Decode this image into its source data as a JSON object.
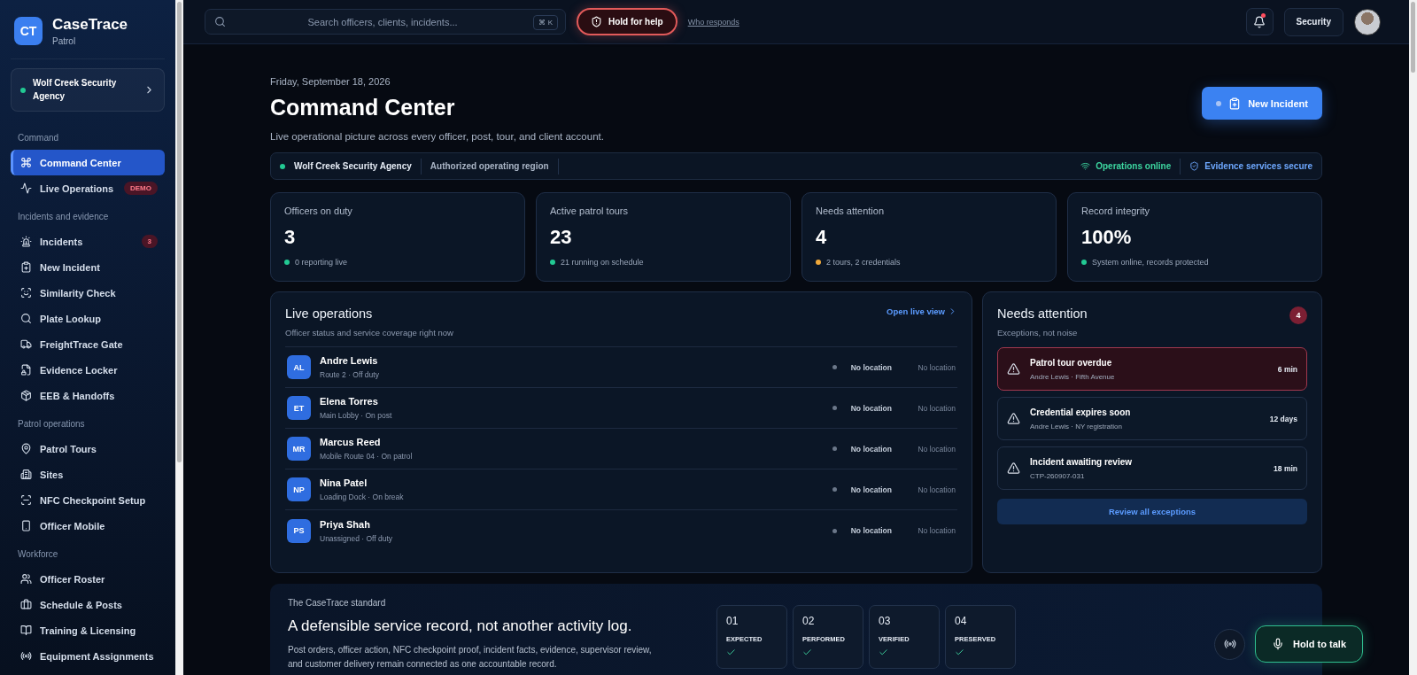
{
  "brand": {
    "logo": "CT",
    "name": "CaseTrace",
    "product": "Patrol"
  },
  "agency": {
    "name": "Wolf Creek Security Agency"
  },
  "sidebar": {
    "sections": [
      {
        "title": "Command",
        "items": [
          {
            "label": "Command Center",
            "selected": true
          },
          {
            "label": "Live Operations",
            "selected": false,
            "badge": "DEMO"
          }
        ]
      },
      {
        "title": "Incidents and evidence",
        "items": [
          {
            "label": "Incidents",
            "selected": false,
            "badge": "3"
          },
          {
            "label": "New Incident",
            "selected": false
          },
          {
            "label": "Similarity Check",
            "selected": false
          },
          {
            "label": "Plate Lookup",
            "selected": false
          },
          {
            "label": "FreightTrace Gate",
            "selected": false
          },
          {
            "label": "Evidence Locker",
            "selected": false
          },
          {
            "label": "EEB & Handoffs",
            "selected": false
          }
        ]
      },
      {
        "title": "Patrol operations",
        "items": [
          {
            "label": "Patrol Tours",
            "selected": false
          },
          {
            "label": "Sites",
            "selected": false
          },
          {
            "label": "NFC Checkpoint Setup",
            "selected": false
          },
          {
            "label": "Officer Mobile",
            "selected": false
          }
        ]
      },
      {
        "title": "Workforce",
        "items": [
          {
            "label": "Officer Roster",
            "selected": false
          },
          {
            "label": "Schedule & Posts",
            "selected": false
          },
          {
            "label": "Training & Licensing",
            "selected": false
          },
          {
            "label": "Equipment Assignments",
            "selected": false
          }
        ]
      }
    ]
  },
  "topbar": {
    "search": {
      "placeholder": "Search officers, clients, incidents...",
      "shortcut": "⌘ K"
    },
    "help_button": "Hold for help",
    "help_link": "Who responds",
    "notifications": {
      "unread": true
    },
    "role_button": "Security"
  },
  "header": {
    "date": "Friday, September 18, 2026",
    "title": "Command Center",
    "subtitle": "Live operational picture across every officer, post, tour, and client account.",
    "action": "New Incident"
  },
  "status_strip": {
    "agency": {
      "name": "Wolf Creek Security Agency",
      "color": "#22c993"
    },
    "region": "Authorized operating region",
    "indicators": [
      {
        "kind": "network",
        "label": "Operations online",
        "color": "#3dd6a0"
      },
      {
        "kind": "shield",
        "label": "Evidence services secure",
        "color": "#6ea8ff"
      }
    ]
  },
  "stats": [
    {
      "label": "Officers on duty",
      "value": "3",
      "note": "0 reporting live",
      "color": "#22c993"
    },
    {
      "label": "Active patrol tours",
      "value": "23",
      "note": "21 running on schedule",
      "color": "#22c993"
    },
    {
      "label": "Needs attention",
      "value": "4",
      "note": "2 tours, 2 credentials",
      "color": "#f0a83a"
    },
    {
      "label": "Record integrity",
      "value": "100%",
      "note": "System online, records protected",
      "color": "#22c993"
    }
  ],
  "live_operations": {
    "title": "Live operations",
    "subtitle": "Officer status and service coverage right now",
    "link": "Open live view",
    "officers": [
      {
        "initials": "AL",
        "name": "Andre Lewis",
        "detail": "Route 2 · Off duty",
        "status": "No location",
        "location": "No location"
      },
      {
        "initials": "ET",
        "name": "Elena Torres",
        "detail": "Main Lobby · On post",
        "status": "No location",
        "location": "No location"
      },
      {
        "initials": "MR",
        "name": "Marcus Reed",
        "detail": "Mobile Route 04 · On patrol",
        "status": "No location",
        "location": "No location"
      },
      {
        "initials": "NP",
        "name": "Nina Patel",
        "detail": "Loading Dock · On break",
        "status": "No location",
        "location": "No location"
      },
      {
        "initials": "PS",
        "name": "Priya Shah",
        "detail": "Unassigned · Off duty",
        "status": "No location",
        "location": "No location"
      }
    ]
  },
  "needs_attention": {
    "title": "Needs attention",
    "count": "4",
    "subtitle": "Exceptions, not noise",
    "items": [
      {
        "title": "Patrol tour overdue",
        "detail": "Andre Lewis · Fifth Avenue",
        "age": "6 min",
        "kind": "urgent"
      },
      {
        "title": "Credential expires soon",
        "detail": "Andre Lewis · NY registration",
        "age": "12 days",
        "kind": "normal"
      },
      {
        "title": "Incident awaiting review",
        "detail": "CTP-260907-031",
        "age": "18 min",
        "kind": "normal"
      }
    ],
    "button": "Review all exceptions"
  },
  "standard": {
    "eyebrow": "The CaseTrace standard",
    "title": "A defensible service record, not another activity log.",
    "body": "Post orders, officer action, NFC checkpoint proof, incident facts, evidence, supervisor review, and customer delivery remain connected as one accountable record.",
    "steps": [
      {
        "number": "01",
        "label": "EXPECTED",
        "checked": true
      },
      {
        "number": "02",
        "label": "PERFORMED",
        "checked": true
      },
      {
        "number": "03",
        "label": "VERIFIED",
        "checked": true
      },
      {
        "number": "04",
        "label": "PRESERVED",
        "checked": true
      }
    ]
  },
  "talk_button": "Hold to talk"
}
